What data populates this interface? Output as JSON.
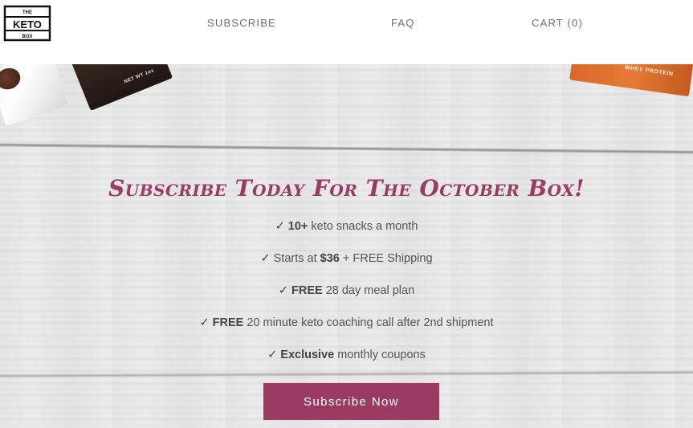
{
  "header": {
    "logo": {
      "top": "THE",
      "main": "KETO",
      "bottom": "BOX"
    },
    "nav": {
      "subscribe": "SUBSCRIBE",
      "faq": "FAQ",
      "cart": "CART (0)"
    }
  },
  "hero": {
    "headline": "Subscribe Today For The October Box!",
    "features": [
      {
        "check": "✓",
        "bold": "10+",
        "rest": " keto snacks a month"
      },
      {
        "check": "✓",
        "pre": "Starts at ",
        "bold": "$36",
        "rest": " + FREE Shipping"
      },
      {
        "check": "✓",
        "bold": "FREE",
        "rest": " 28 day meal plan"
      },
      {
        "check": "✓",
        "bold": "FREE",
        "rest": " 20 minute keto coaching call after 2nd shipment"
      },
      {
        "check": "✓",
        "bold": "Exclusive",
        "rest": " monthly coupons"
      }
    ],
    "cta_label": "Subscribe Now",
    "package_labels": {
      "mid": "NET WT 1oz",
      "right": "WHEY PROTEIN"
    }
  },
  "colors": {
    "accent": "#9b3b62",
    "nav_text": "#6b6b6b",
    "body_text": "#555555"
  }
}
